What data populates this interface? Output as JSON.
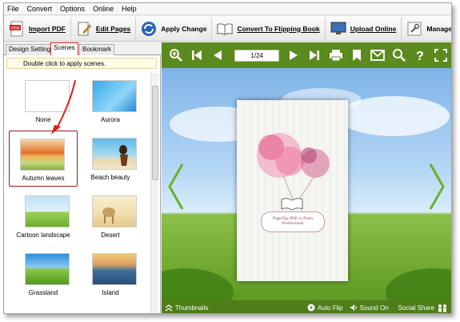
{
  "menu": [
    "File",
    "Convert",
    "Options",
    "Online",
    "Help"
  ],
  "toolbar": {
    "import_pdf": "Import PDF",
    "edit_pages": "Edit Pages",
    "apply_change": "Apply Change",
    "convert": "Convert To Flipping Book",
    "upload": "Upload Online",
    "manage": "Manage O"
  },
  "tabs": {
    "design": "Design Setting",
    "scenes": "Scenes",
    "bookmark": "Bookmark"
  },
  "hint": "Double click to apply scenes.",
  "scenes": [
    {
      "name": "None"
    },
    {
      "name": "Aurora"
    },
    {
      "name": "Autumn leaves"
    },
    {
      "name": "Beach beauty"
    },
    {
      "name": "Cartoon landscape"
    },
    {
      "name": "Desert"
    },
    {
      "name": "Grassland"
    },
    {
      "name": "Island"
    }
  ],
  "viewer": {
    "page_indicator": "1/24",
    "book_subtitle": "PageFlip PDF to Flash Professional",
    "thumbnails": "Thumbnails",
    "auto_flip": "Auto Flip",
    "sound_on": "Sound On",
    "social_share": "Social Share"
  },
  "colors": {
    "viewer_bar": "#5b8a1e",
    "selection": "#d02020"
  }
}
